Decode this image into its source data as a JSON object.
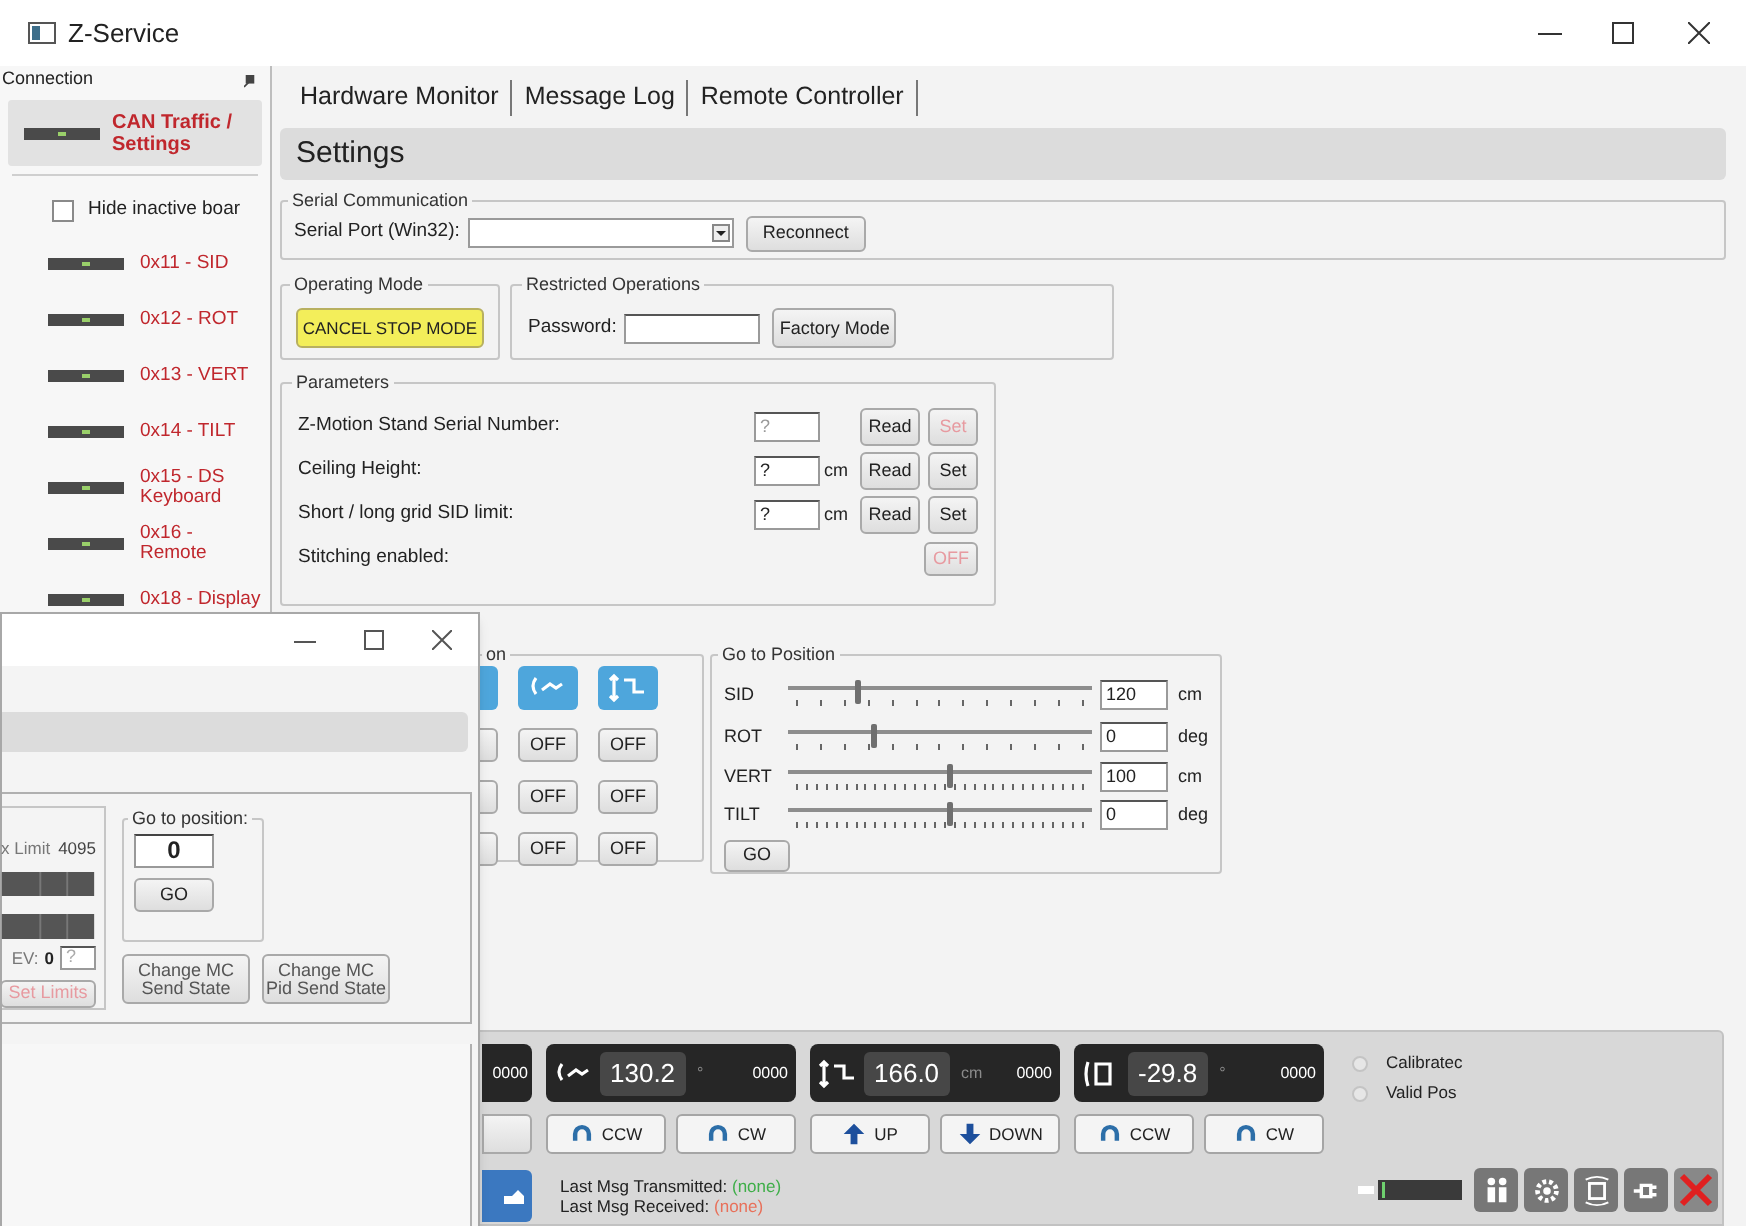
{
  "window": {
    "title": "Z-Service"
  },
  "sidebar": {
    "title": "Connection",
    "settings_item": {
      "label": "CAN Traffic / Settings",
      "selected": true
    },
    "hide_checkbox": {
      "label": "Hide inactive boar",
      "checked": false
    },
    "boards": [
      {
        "label": "0x11 - SID",
        "selected": false
      },
      {
        "label": "0x12 - ROT",
        "selected": false
      },
      {
        "label": "0x13 - VERT",
        "selected": false
      },
      {
        "label": "0x14 - TILT",
        "selected": false
      },
      {
        "label": "0x15 - DS Keyboard",
        "selected": false
      },
      {
        "label": "0x16 - Remote",
        "selected": false
      },
      {
        "label": "0x18 - Display",
        "selected": false
      }
    ]
  },
  "tabs": [
    {
      "label": "Hardware Monitor"
    },
    {
      "label": "Message Log"
    },
    {
      "label": "Remote Controller"
    }
  ],
  "settings": {
    "title": "Settings",
    "serial": {
      "title": "Serial Communication",
      "label": "Serial Port (Win32):",
      "button": "Reconnect"
    },
    "operating_mode": {
      "title": "Operating Mode",
      "button": "CANCEL STOP MODE"
    },
    "restricted": {
      "title": "Restricted Operations",
      "label": "Password:",
      "button": "Factory Mode"
    },
    "parameters": {
      "title": "Parameters",
      "rows": [
        {
          "kind": "field",
          "label": "Z-Motion Stand Serial Number:",
          "value": "?",
          "disabled": true,
          "buttons": [
            {
              "label": "Read",
              "disabled": false
            },
            {
              "label": "Set",
              "disabled": true
            }
          ]
        },
        {
          "kind": "field",
          "label": "Ceiling Height:",
          "value": "?",
          "unit": "cm",
          "disabled": false,
          "buttons": [
            {
              "label": "Read",
              "disabled": false
            },
            {
              "label": "Set",
              "disabled": false
            }
          ]
        },
        {
          "kind": "field",
          "label": "Short / long grid SID limit:",
          "value": "?",
          "unit": "cm",
          "disabled": false,
          "buttons": [
            {
              "label": "Read",
              "disabled": false
            },
            {
              "label": "Set",
              "disabled": false
            }
          ]
        },
        {
          "kind": "toggle",
          "label": "Stitching enabled:",
          "toggle": {
            "label": "OFF",
            "disabled": true
          }
        }
      ]
    }
  },
  "motion": {
    "title": "on",
    "columns": [
      {
        "kind": "rotate",
        "toggles": [
          "OFF",
          "OFF",
          "OFF"
        ]
      },
      {
        "kind": "vertical",
        "toggles": [
          "OFF",
          "OFF",
          "OFF"
        ]
      }
    ]
  },
  "go_to_position": {
    "title": "Go to Position",
    "rows": [
      {
        "label": "SID",
        "kind": "coarse",
        "level": 0.23,
        "value": "120",
        "unit": "cm"
      },
      {
        "label": "ROT",
        "kind": "coarse",
        "level": 0.28,
        "value": "0",
        "unit": "deg"
      },
      {
        "label": "VERT",
        "kind": "fine",
        "level": 0.53,
        "value": "100",
        "unit": "cm"
      },
      {
        "label": "TILT",
        "kind": "fine",
        "level": 0.53,
        "value": "0",
        "unit": "deg"
      }
    ],
    "button": "GO"
  },
  "axes": [
    {
      "kind": "partial",
      "counter": "0000"
    },
    {
      "kind": "rotate",
      "value": "130.2",
      "unit": "°",
      "counter": "0000",
      "buttons": [
        {
          "kind": "ccw",
          "label": "CCW"
        },
        {
          "kind": "cw",
          "label": "CW"
        }
      ]
    },
    {
      "kind": "vertical",
      "value": "166.0",
      "unit": "cm",
      "counter": "0000",
      "buttons": [
        {
          "kind": "up",
          "label": "UP"
        },
        {
          "kind": "down",
          "label": "DOWN"
        }
      ]
    },
    {
      "kind": "tilt",
      "value": "-29.8",
      "unit": "°",
      "counter": "0000",
      "buttons": [
        {
          "kind": "ccw",
          "label": "CCW"
        },
        {
          "kind": "cw",
          "label": "CW"
        }
      ]
    }
  ],
  "status_radios": [
    {
      "label": "Calibratec",
      "checked": false
    },
    {
      "label": "Valid Pos",
      "checked": false
    }
  ],
  "messages": [
    {
      "label": "Last Msg Transmitted:",
      "value": "(none)",
      "color": "#3fae49"
    },
    {
      "label": "Last Msg Received:",
      "value": "(none)",
      "color": "#e8705a"
    }
  ],
  "second_window": {
    "limit_label": "x Limit",
    "limit_value": "4095",
    "ev_label": "EV:",
    "ev_value": "0",
    "ev_field": "?",
    "set_limits": {
      "label": "Set Limits",
      "disabled": true
    },
    "go_to": {
      "title": "Go to position:",
      "value": "0",
      "button": "GO"
    },
    "buttons": [
      "Change MC\nSend State",
      "Change MC\nPid Send State"
    ]
  }
}
